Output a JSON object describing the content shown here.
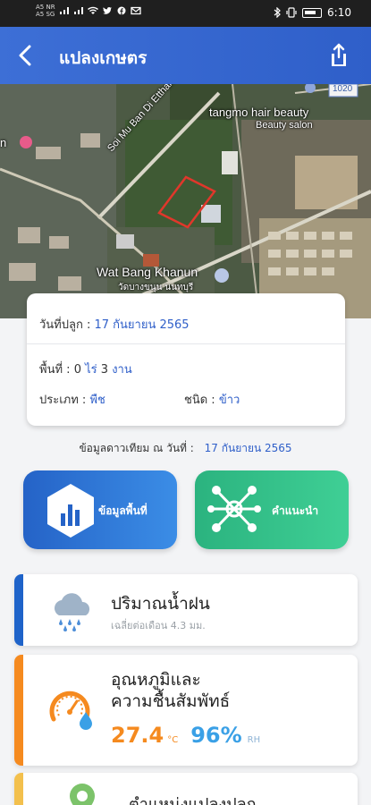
{
  "status_bar": {
    "sim1": "A5 NR",
    "sim2": "A5 SG",
    "time": "6:10"
  },
  "app_bar": {
    "title": "แปลงเกษตร"
  },
  "map": {
    "labels": {
      "road": "Soi Mu Ban Di Etthan",
      "shop": "tangmo hair beauty",
      "shop_type": "Beauty salon",
      "temple": "Wat Bang Khanun",
      "temple_th": "วัดบางขนุน นนทบุรี",
      "route": "1020",
      "left_cut": "n"
    }
  },
  "plot_info": {
    "planted_label": "วันที่ปลูก :",
    "planted_value": "17 กันยายน 2565",
    "area_label": "พื้นที่ :",
    "area_rai": "0",
    "rai_unit": "ไร่",
    "area_ngan": "3",
    "ngan_unit": "งาน",
    "type_label": "ประเภท :",
    "type_value": "พืช",
    "kind_label": "ชนิด :",
    "kind_value": "ข้าว"
  },
  "satellite": {
    "label": "ข้อมูลดาวเทียม ณ วันที่ :",
    "date": "17 กันยายน 2565"
  },
  "actions": {
    "area_info": "ข้อมูลพื้นที่",
    "advice": "คำแนะนำ"
  },
  "rainfall": {
    "title": "ปริมาณน้ำฝน",
    "subtitle": "เฉลี่ยต่อเดือน 4.3 มม."
  },
  "climate": {
    "title": "อุณหภูมิและความชื้นสัมพัทธ์",
    "temperature": "27.4",
    "temp_unit": "°C",
    "humidity": "96%",
    "humidity_unit": "RH"
  },
  "location": {
    "title": "ตำแหน่งแปลงปลูก"
  },
  "colors": {
    "primary": "#2f5fc9",
    "green": "#3fcf95",
    "orange": "#f58a1f",
    "rain_bar": "#1e63c9",
    "location_bar": "#f3c04d"
  },
  "icons": [
    "back-arrow-icon",
    "share-icon",
    "bar-chart-icon",
    "network-icon",
    "rain-cloud-icon",
    "thermometer-gauge-icon",
    "location-pin-icon"
  ]
}
